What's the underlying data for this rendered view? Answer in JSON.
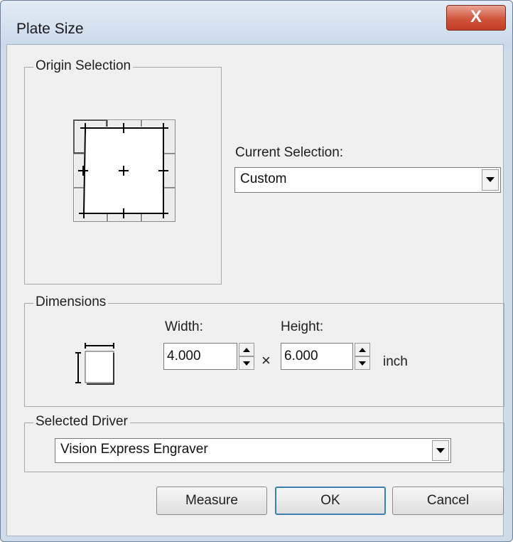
{
  "window": {
    "title": "Plate Size",
    "close_glyph": "X"
  },
  "origin_selection": {
    "label": "Origin Selection",
    "current_selection_label": "Current Selection:",
    "current_selection_value": "Custom"
  },
  "dimensions": {
    "label": "Dimensions",
    "width_label": "Width:",
    "height_label": "Height:",
    "width_value": "4.000",
    "height_value": "6.000",
    "times_glyph": "×",
    "unit": "inch"
  },
  "driver": {
    "label": "Selected Driver",
    "value": "Vision Express Engraver"
  },
  "buttons": {
    "measure": "Measure",
    "ok": "OK",
    "cancel": "Cancel"
  }
}
